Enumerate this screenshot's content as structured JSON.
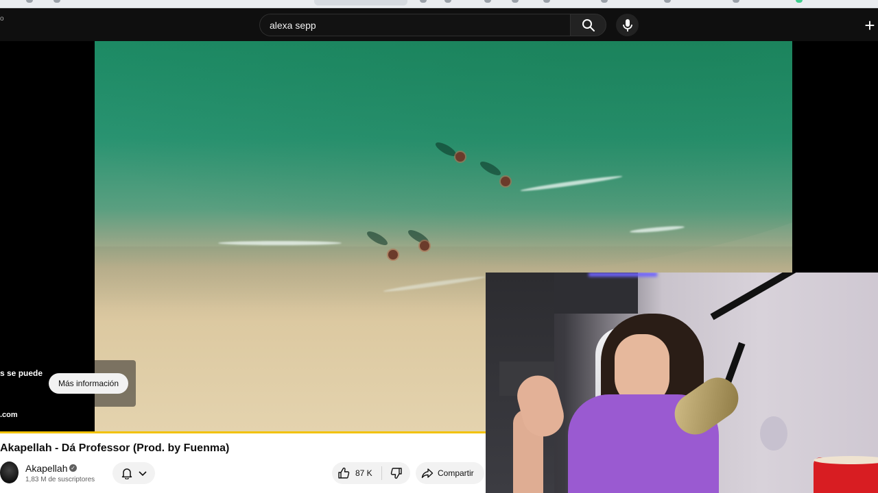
{
  "search": {
    "query": "alexa sepp"
  },
  "ad": {
    "text_line": "s se puede",
    "url_fragment": ".com",
    "more_info_label": "Más información"
  },
  "video": {
    "title": "Akapellah - Dá Professor (Prod. by Fuenma)"
  },
  "channel": {
    "name": "Akapellah",
    "subscribers": "1,83 M de suscriptores"
  },
  "actions": {
    "like_count": "87 K",
    "share_label": "Compartir"
  },
  "icons": {
    "search": "search-icon",
    "mic": "microphone-icon",
    "create": "plus-icon",
    "bell": "bell-icon",
    "chevron": "chevron-down-icon",
    "like": "thumbs-up-icon",
    "dislike": "thumbs-down-icon",
    "share": "share-icon",
    "verified": "verified-icon"
  },
  "colors": {
    "progress": "#f2c200",
    "topbar": "#0f0f0f"
  }
}
